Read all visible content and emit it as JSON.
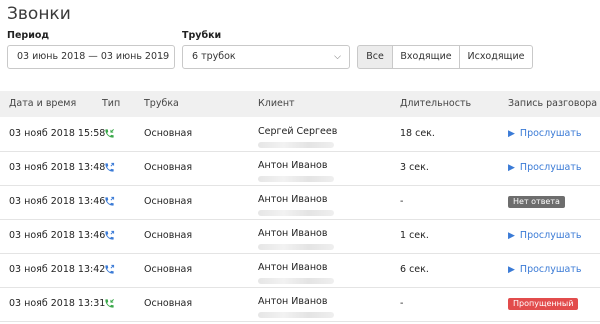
{
  "page_title": "Звонки",
  "filters": {
    "period_label": "Период",
    "period_value": "03 июнь 2018 — 03 июнь 2019",
    "phones_label": "Трубки",
    "phones_value": "6 трубок",
    "direction_tabs": [
      "Все",
      "Входящие",
      "Исходящие"
    ]
  },
  "table": {
    "headers": [
      "Дата и время",
      "Тип",
      "Трубка",
      "Клиент",
      "Длительность",
      "Запись разговора"
    ],
    "rows": [
      {
        "datetime": "03 нояб 2018 15:58",
        "type_icon": "phone-incoming-icon",
        "type_color": "#3aa84a",
        "phone": "Основная",
        "client": "Сергей Сергеев",
        "duration": "18 сек.",
        "record": {
          "kind": "play",
          "label": "Прослушать"
        }
      },
      {
        "datetime": "03 нояб 2018 13:48",
        "type_icon": "phone-outgoing-icon",
        "type_color": "#3b7bd6",
        "phone": "Основная",
        "client": "Антон Иванов",
        "duration": "3 сек.",
        "record": {
          "kind": "play",
          "label": "Прослушать"
        }
      },
      {
        "datetime": "03 нояб 2018 13:46",
        "type_icon": "phone-outgoing-icon",
        "type_color": "#3b7bd6",
        "phone": "Основная",
        "client": "Антон Иванов",
        "duration": "-",
        "record": {
          "kind": "badge",
          "label": "Нет ответа",
          "color": "#6d6d6d"
        }
      },
      {
        "datetime": "03 нояб 2018 13:46",
        "type_icon": "phone-outgoing-icon",
        "type_color": "#3b7bd6",
        "phone": "Основная",
        "client": "Антон Иванов",
        "duration": "1 сек.",
        "record": {
          "kind": "play",
          "label": "Прослушать"
        }
      },
      {
        "datetime": "03 нояб 2018 13:42",
        "type_icon": "phone-outgoing-icon",
        "type_color": "#3b7bd6",
        "phone": "Основная",
        "client": "Антон Иванов",
        "duration": "6 сек.",
        "record": {
          "kind": "play",
          "label": "Прослушать"
        }
      },
      {
        "datetime": "03 нояб 2018 13:31",
        "type_icon": "phone-incoming-icon",
        "type_color": "#3aa84a",
        "phone": "Основная",
        "client": "Антон Иванов",
        "duration": "-",
        "record": {
          "kind": "badge",
          "label": "Пропущенный",
          "color": "#e24c4c"
        }
      }
    ]
  }
}
